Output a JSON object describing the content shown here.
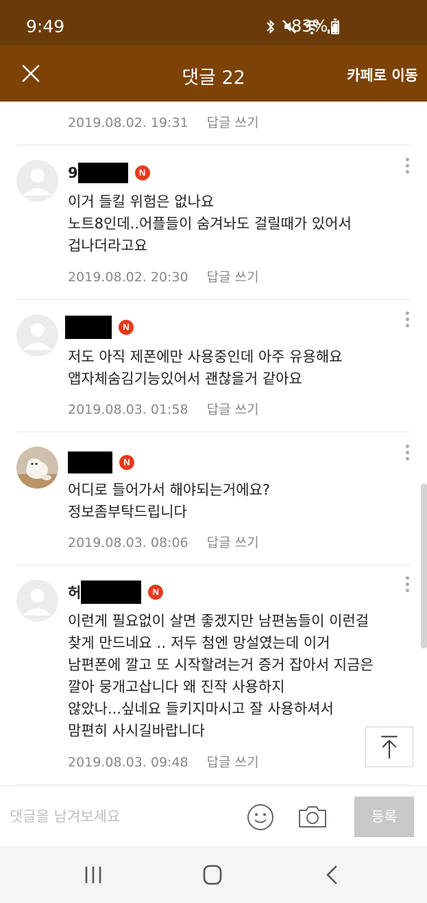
{
  "status_bar": {
    "time": "9:49",
    "battery": "83%"
  },
  "header": {
    "title": "댓글 22",
    "cafe_link": "카페로 이동"
  },
  "top_comment_meta": {
    "date": "2019.08.02. 19:31",
    "reply": "답글 쓰기"
  },
  "comments": [
    {
      "name_prefix": "9",
      "badge": "N",
      "lines": [
        "이거 들킬 위험은 없나요",
        "노트8인데..어플들이 숨겨놔도 걸릴때가 있어서",
        "겁나더라고요"
      ],
      "date": "2019.08.02. 20:30",
      "reply": "답글 쓰기"
    },
    {
      "name_prefix": "",
      "badge": "N",
      "lines": [
        "저도 아직 제폰에만 사용중인데 아주 유용해요",
        "앱자체숨김기능있어서 괜찮을거 같아요"
      ],
      "date": "2019.08.03. 01:58",
      "reply": "답글 쓰기"
    },
    {
      "name_prefix": "",
      "badge": "N",
      "lines": [
        "어디로 들어가서 해야되는거에요?",
        "정보좀부탁드립니다"
      ],
      "date": "2019.08.03. 08:06",
      "reply": "답글 쓰기"
    },
    {
      "name_prefix": "허",
      "badge": "N",
      "lines": [
        "이런게 필요없이 살면 좋겠지만 남편놈들이 이런걸",
        "찾게 만드네요 ‥ 저두 첨엔 망설였는데 이거",
        "남편폰에 깔고 또 시작할려는거 증거 잡아서 지금은",
        "깔아 뭉개고삽니다 왜 진작 사용하지",
        "않았나...싶네요 들키지마시고 잘 사용하셔서",
        "맘편히 사시길바랍니다"
      ],
      "date": "2019.08.03. 09:48",
      "reply": "답글 쓰기"
    }
  ],
  "input_bar": {
    "placeholder": "댓글을 남겨보세요",
    "submit_label": "등록"
  },
  "colors": {
    "status_bar": "#6a3b0a",
    "header": "#7d4206",
    "badge": "#e53a1c"
  },
  "icons": [
    "close-icon",
    "more-icon",
    "emoji-icon",
    "camera-icon",
    "scroll-top-icon",
    "nav-recents-icon",
    "nav-home-icon",
    "nav-back-icon"
  ]
}
